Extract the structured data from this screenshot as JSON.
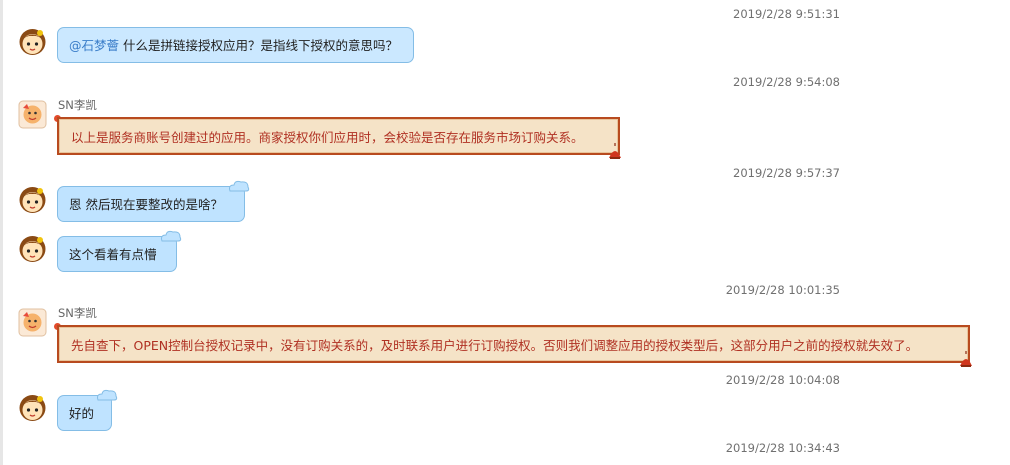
{
  "timestamps": [
    "2019/2/28 9:51:31",
    "2019/2/28 9:54:08",
    "2019/2/28 9:57:37",
    "2019/2/28 10:01:35",
    "2019/2/28 10:04:08",
    "2019/2/28 10:34:43"
  ],
  "messages": [
    {
      "mention": "@石梦薈",
      "text": " 什么是拼链接授权应用？是指线下授权的意思吗？"
    },
    {
      "sender": "SN李凯",
      "text": "以上是服务商账号创建过的应用。商家授权你们应用时，会校验是否存在服务市场订购关系。"
    },
    {
      "text": "恩 然后现在要整改的是啥？"
    },
    {
      "text": "这个看着有点懵"
    },
    {
      "sender": "SN李凯",
      "text": "先自查下，OPEN控制台授权记录中，没有订购关系的，及时联系用户进行订购授权。否则我们调整应用的授权类型后，这部分用户之前的授权就失效了。"
    },
    {
      "text": "好的"
    }
  ],
  "icons": {
    "user_avatar": "cartoon-girl-avatar-icon",
    "agent_avatar": "agent-avatar-icon",
    "ornament": "lantern-ornament-icon"
  },
  "colors": {
    "blue_bubble": "#bfe3ff",
    "red_bubble_bg": "#f5e3c7",
    "red_bubble_border": "#b84b1f",
    "red_text": "#b03022",
    "mention": "#3a7dc9"
  }
}
